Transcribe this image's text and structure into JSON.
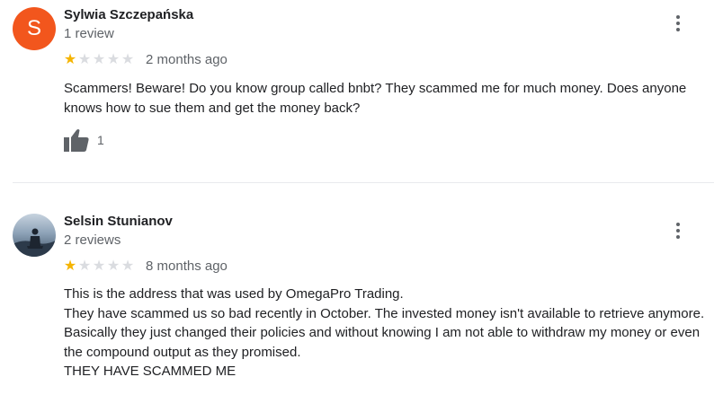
{
  "reviews": [
    {
      "name": "Sylwia Szczepańska",
      "avatar_letter": "S",
      "review_count": "1 review",
      "rating": 1,
      "max_rating": 5,
      "time_ago": "2 months ago",
      "text": [
        "Scammers! Beware! Do you know group called bnbt? They scammed me for much money. Does anyone knows how to sue them and get the money back?"
      ],
      "likes": "1"
    },
    {
      "name": "Selsin Stunianov",
      "review_count": "2 reviews",
      "rating": 1,
      "max_rating": 5,
      "time_ago": "8 months ago",
      "text": [
        "This is the address that was used by OmegaPro Trading.",
        "They have scammed us so bad recently in October. The invested money isn't available to retrieve anymore.",
        "Basically they just changed their policies and without knowing I am not able to withdraw my money or even the compound output as they promised.",
        "THEY HAVE SCAMMED ME"
      ]
    }
  ],
  "colors": {
    "avatar_bg": "#f2561d",
    "star_filled": "#f5b400",
    "star_empty": "#dadce0",
    "secondary_text": "#5f6368"
  },
  "icons": [
    "more-vert-icon",
    "thumbs-up-icon",
    "star-icon"
  ]
}
